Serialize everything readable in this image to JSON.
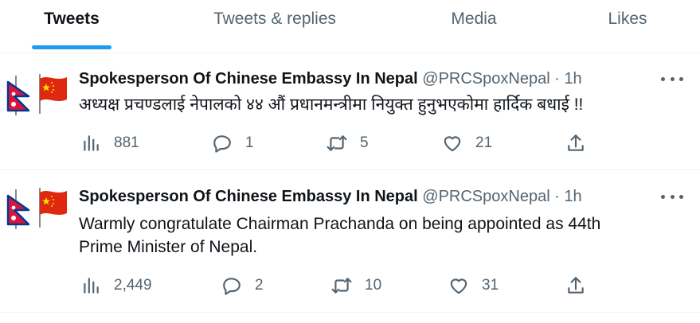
{
  "tabs": [
    {
      "label": "Tweets",
      "active": true
    },
    {
      "label": "Tweets & replies",
      "active": false
    },
    {
      "label": "Media",
      "active": false
    },
    {
      "label": "Likes",
      "active": false
    }
  ],
  "tweets": [
    {
      "name": "Spokesperson Of Chinese Embassy In Nepal",
      "handle": "@PRCSpoxNepal",
      "dot": "·",
      "time": "1h",
      "text_lines": [
        "अध्यक्ष प्रचण्डलाई नेपालको ४४ औं प्रधानमन्त्रीमा नियुक्त हुनुभएकोमा हार्दिक बधाई !!"
      ],
      "views": "881",
      "replies": "1",
      "retweets": "5",
      "likes": "21"
    },
    {
      "name": "Spokesperson Of Chinese Embassy In Nepal",
      "handle": "@PRCSpoxNepal",
      "dot": "·",
      "time": "1h",
      "text_lines": [
        "Warmly congratulate Chairman Prachanda on being appointed as 44th",
        "Prime Minister of Nepal."
      ],
      "views": "2,449",
      "replies": "2",
      "retweets": "10",
      "likes": "31"
    }
  ],
  "icons": {
    "avatar": "nepal-china-flags-icon",
    "views": "views-bar-chart-icon",
    "reply": "reply-bubble-icon",
    "retweet": "retweet-icon",
    "like": "heart-icon",
    "share": "share-upload-icon",
    "more": "more-dots-icon"
  },
  "colors": {
    "accent": "#1d9bf0",
    "text_primary": "#0f1419",
    "text_secondary": "#536471",
    "divider": "#eff3f4",
    "nepal_red": "#dc143c",
    "nepal_blue": "#003893",
    "china_red": "#de2910",
    "china_star": "#ffde00"
  }
}
